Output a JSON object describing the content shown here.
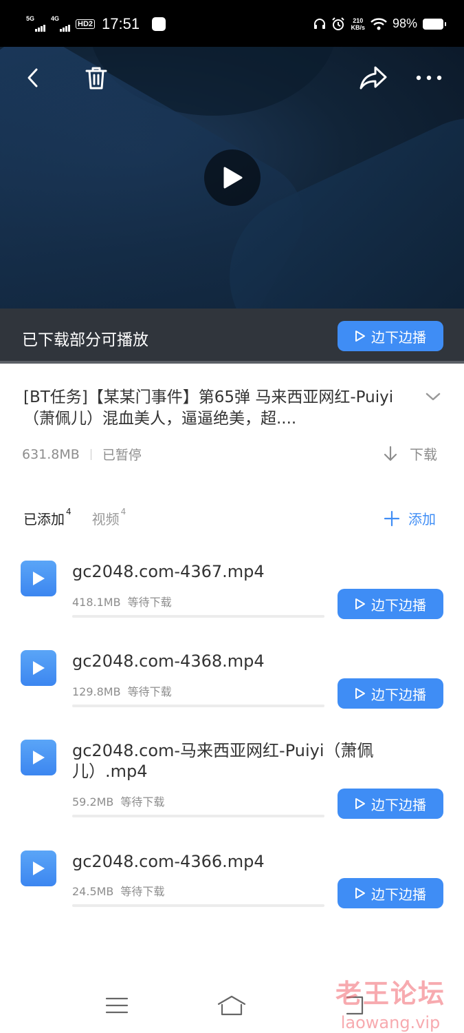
{
  "status_bar": {
    "sim1": "5G",
    "sim2": "4G",
    "hd": "HD2",
    "time": "17:51",
    "speed_value": "210",
    "speed_unit": "KB/s",
    "battery": "98%"
  },
  "player": {
    "partial_text": "已下载部分可播放",
    "stream_button": "边下边播"
  },
  "task": {
    "title": "[BT任务]【某某门事件】第65弹 马来西亚网红-Puiyi（萧佩儿）混血美人，逼逼绝美，超....",
    "size": "631.8MB",
    "status": "已暂停",
    "download_label": "下载"
  },
  "tabs": [
    {
      "label": "已添加",
      "count": "4"
    },
    {
      "label": "视频",
      "count": "4"
    }
  ],
  "add_label": "添加",
  "files": [
    {
      "name": "gc2048.com-4367.mp4",
      "size": "418.1MB",
      "status": "等待下载",
      "button": "边下边播"
    },
    {
      "name": "gc2048.com-4368.mp4",
      "size": "129.8MB",
      "status": "等待下载",
      "button": "边下边播"
    },
    {
      "name": "gc2048.com-马来西亚网红-Puiyi（萧佩儿）.mp4",
      "size": "59.2MB",
      "status": "等待下载",
      "button": "边下边播"
    },
    {
      "name": "gc2048.com-4366.mp4",
      "size": "24.5MB",
      "status": "等待下载",
      "button": "边下边播"
    }
  ],
  "watermark": {
    "cn": "老王论坛",
    "en": "laowang.vip"
  },
  "colors": {
    "accent": "#3f8df5",
    "bar_bg": "#30353c",
    "muted": "#8d8d8d"
  }
}
